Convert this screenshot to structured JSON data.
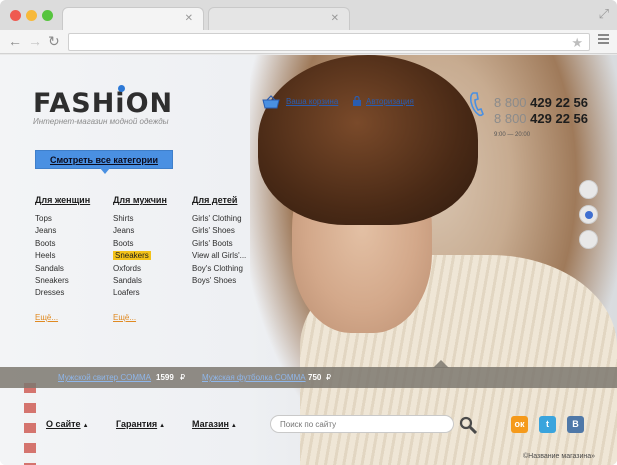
{
  "browser": {
    "active_tab": "",
    "inactive_tab": "",
    "url": "",
    "traffic_lights": [
      "#ef5a50",
      "#f7b93a",
      "#56c43e"
    ]
  },
  "brand": {
    "logo_pre": "FASH",
    "logo_i": "i",
    "logo_post": "ON",
    "tagline": "Интернет-магазин модной одежды"
  },
  "header": {
    "cart_label": "Ваша корзина",
    "auth_label": "Авторизация",
    "phones": [
      {
        "prefix": "8 800",
        "number": "429 22 56"
      },
      {
        "prefix": "8 800",
        "number": "429 22 56"
      }
    ],
    "hours": "9:00 — 20:00"
  },
  "categories_button": "Смотреть все категории",
  "columns": [
    {
      "title": "Для женщин",
      "items": [
        "Tops",
        "Jeans",
        "Boots",
        "Heels",
        "Sandals",
        "Sneakers",
        "Dresses"
      ],
      "highlight": -1,
      "more": "Ещё..."
    },
    {
      "title": "Для мужчин",
      "items": [
        "Shirts",
        "Jeans",
        "Boots",
        "Sneakers",
        "Oxfords",
        "Sandals",
        "Loafers"
      ],
      "highlight": 3,
      "more": "Ещё..."
    },
    {
      "title": "Для детей",
      "items": [
        "Girls' Clothing",
        "Girls' Shoes",
        "Girls' Boots",
        "View all Girls'...",
        "Boy's Clothing",
        "Boys' Shoes"
      ],
      "highlight": -1,
      "more": ""
    }
  ],
  "slider": {
    "count": 3,
    "active_index": 1
  },
  "promo": [
    {
      "name": "Мужской свитер COMMA",
      "price": "1599",
      "currency": "₽"
    },
    {
      "name": "Мужская футболка COMMA",
      "price": "750",
      "currency": "₽"
    }
  ],
  "footer": {
    "nav": [
      "О сайте",
      "Гарантия",
      "Магазин"
    ],
    "search_placeholder": "Поиск по сайту",
    "social": [
      {
        "icon": "odnoklassniki-icon",
        "glyph": "ок",
        "color": "#f59a1b"
      },
      {
        "icon": "twitter-icon",
        "glyph": "t",
        "color": "#3aa4dd"
      },
      {
        "icon": "vk-icon",
        "glyph": "В",
        "color": "#4f78a8"
      }
    ],
    "copyright": "©Название магазина»"
  },
  "colors": {
    "accent": "#4a90e2",
    "highlight": "#f3c21a",
    "link": "#2a5db0",
    "more": "#e08a22"
  }
}
